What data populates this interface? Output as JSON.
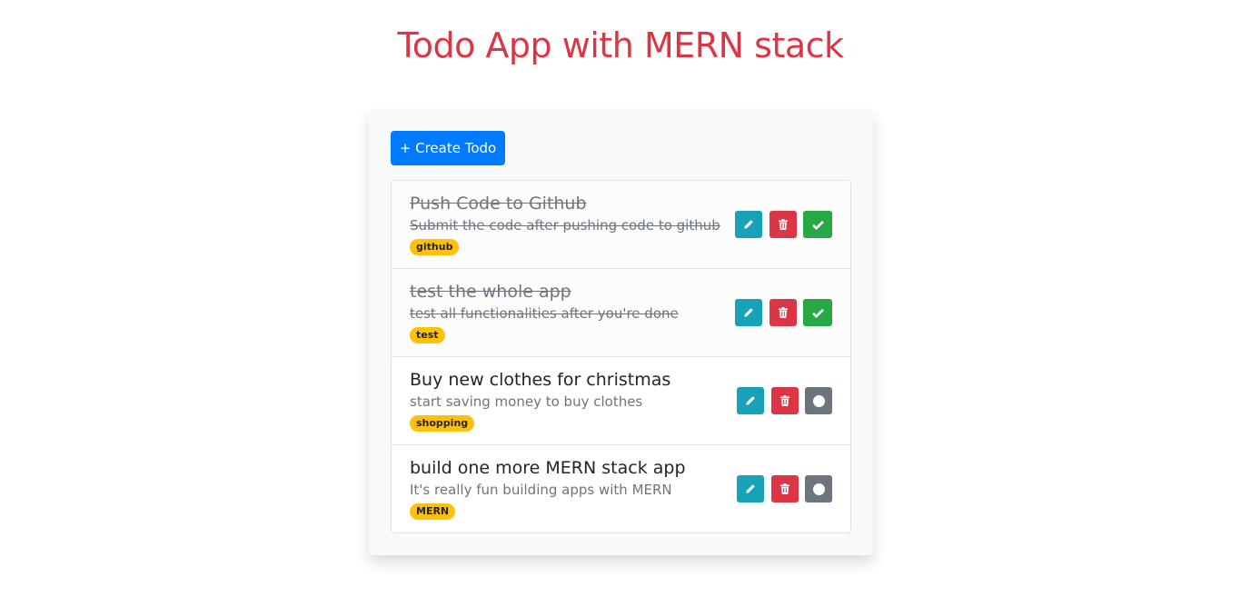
{
  "header": {
    "title": "Todo App with MERN stack"
  },
  "toolbar": {
    "create_label": "+ Create Todo"
  },
  "colors": {
    "title": "#dc3545",
    "primary": "#007bff",
    "edit": "#17a2b8",
    "delete": "#dc3545",
    "complete": "#28a745",
    "pending": "#6c757d",
    "tag": "#ffc107"
  },
  "todos": [
    {
      "title": "Push Code to Github",
      "description": "Submit the code after pushing code to github",
      "tag": "github",
      "completed": true,
      "icons": [
        "pencil-icon",
        "trash-icon",
        "check-icon"
      ]
    },
    {
      "title": "test the whole app",
      "description": "test all functionalities after you're done",
      "tag": "test",
      "completed": true,
      "icons": [
        "pencil-icon",
        "trash-icon",
        "check-icon"
      ]
    },
    {
      "title": "Buy new clothes for christmas",
      "description": "start saving money to buy clothes",
      "tag": "shopping",
      "completed": false,
      "icons": [
        "pencil-icon",
        "trash-icon",
        "circle-icon"
      ]
    },
    {
      "title": "build one more MERN stack app",
      "description": "It's really fun building apps with MERN",
      "tag": "MERN",
      "completed": false,
      "icons": [
        "pencil-icon",
        "trash-icon",
        "circle-icon"
      ]
    }
  ]
}
